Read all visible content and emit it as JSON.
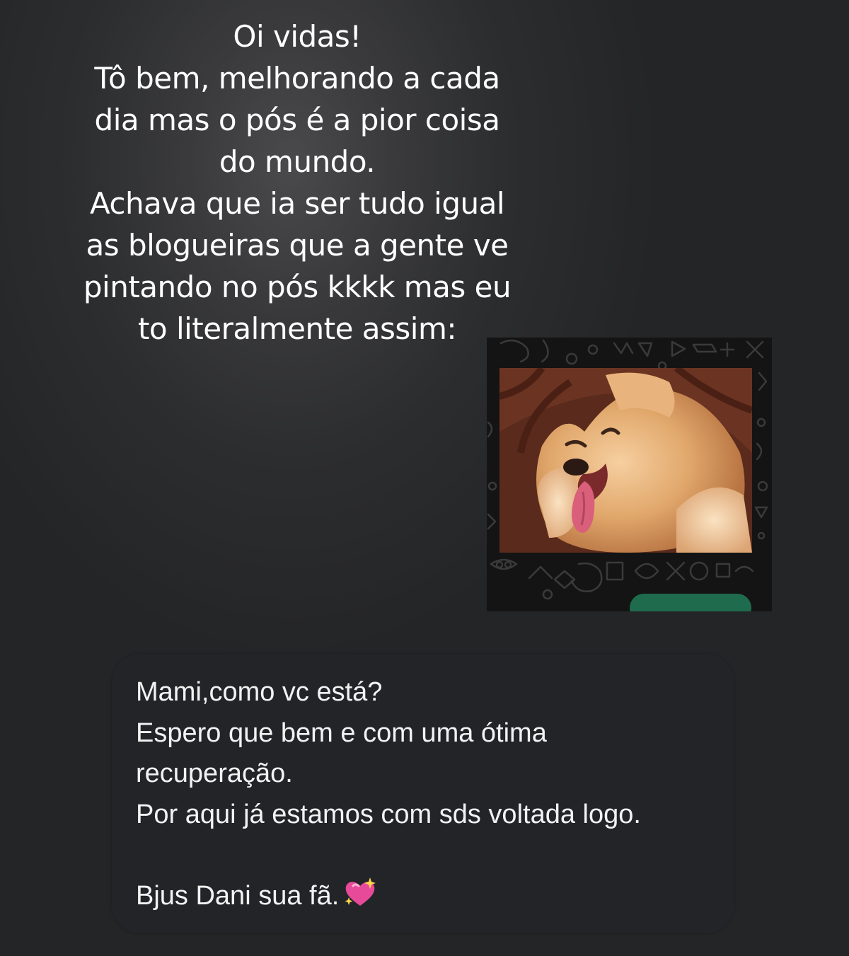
{
  "story": {
    "caption_lines": [
      "Oi vidas!",
      "Tô bem, melhorando a cada",
      "dia mas o pós é a pior coisa",
      "do mundo.",
      "Achava que ia ser tudo igual",
      "as blogueiras que a gente ve",
      "pintando no pós kkkk mas eu",
      "to literalmente assim:"
    ]
  },
  "sticker": {
    "image": "dog-sticker",
    "background_icons": "chat-doodle-pattern"
  },
  "message": {
    "lines": [
      "Mami,como vc está?",
      "Espero que bem e com uma ótima",
      "recuperação.",
      "Por aqui já estamos com sds voltada logo.",
      "",
      "Bjus Dani sua fã."
    ],
    "emoji": "sparkling-heart-icon"
  },
  "colors": {
    "background": "#242527",
    "bubble": "#222428",
    "text": "#ffffff",
    "time_pill": "#1f6b4e",
    "heart": "#e84a9a"
  }
}
